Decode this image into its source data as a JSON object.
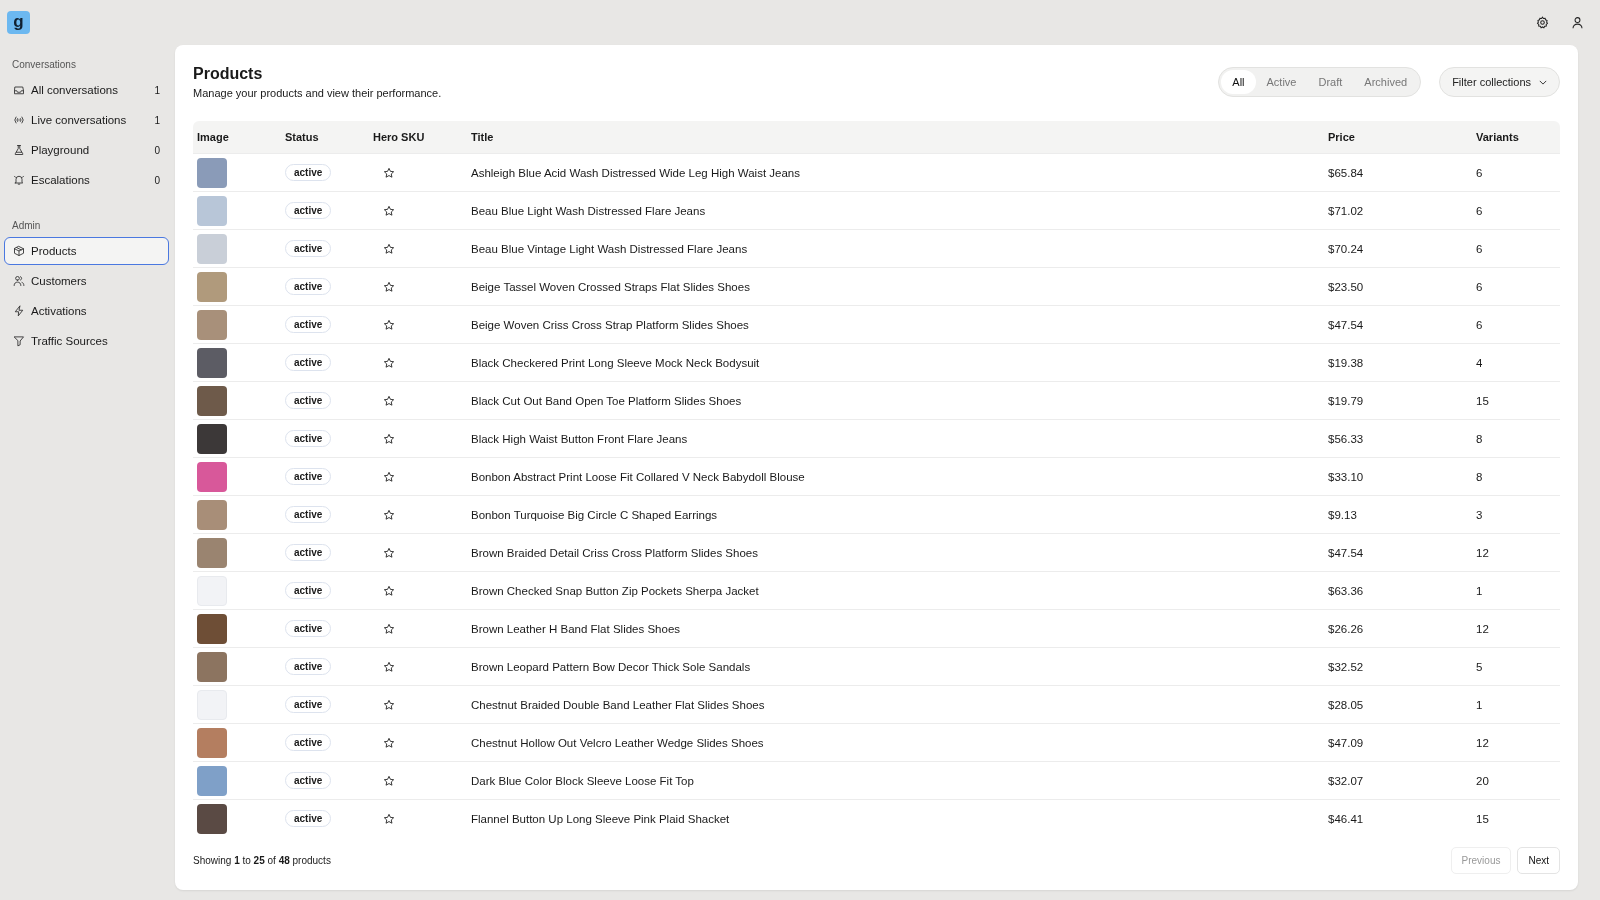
{
  "app": {
    "logo": "g"
  },
  "sidebar": {
    "sections": [
      {
        "heading": "Conversations",
        "items": [
          {
            "label": "All conversations",
            "count": "1",
            "selected": false
          },
          {
            "label": "Live conversations",
            "count": "1",
            "selected": false
          },
          {
            "label": "Playground",
            "count": "0",
            "selected": false
          },
          {
            "label": "Escalations",
            "count": "0",
            "selected": false
          }
        ]
      },
      {
        "heading": "Admin",
        "items": [
          {
            "label": "Products",
            "selected": true
          },
          {
            "label": "Customers",
            "selected": false
          },
          {
            "label": "Activations",
            "selected": false
          },
          {
            "label": "Traffic Sources",
            "selected": false
          }
        ]
      }
    ]
  },
  "page": {
    "title": "Products",
    "subtitle": "Manage your products and view their performance."
  },
  "filters": [
    {
      "label": "All",
      "selected": true
    },
    {
      "label": "Active",
      "selected": false
    },
    {
      "label": "Draft",
      "selected": false
    },
    {
      "label": "Archived",
      "selected": false
    }
  ],
  "collections_filter": {
    "label": "Filter collections"
  },
  "table": {
    "columns": [
      "Image",
      "Status",
      "Hero SKU",
      "Title",
      "Price",
      "Variants"
    ],
    "rows": [
      {
        "has_image": true,
        "status": "active",
        "hero": false,
        "title": "Ashleigh Blue Acid Wash Distressed Wide Leg High Waist Jeans",
        "price": "$65.84",
        "variants": "6"
      },
      {
        "has_image": true,
        "status": "active",
        "hero": false,
        "title": "Beau Blue Light Wash Distressed Flare Jeans",
        "price": "$71.02",
        "variants": "6"
      },
      {
        "has_image": true,
        "status": "active",
        "hero": false,
        "title": "Beau Blue Vintage Light Wash Distressed Flare Jeans",
        "price": "$70.24",
        "variants": "6"
      },
      {
        "has_image": true,
        "status": "active",
        "hero": false,
        "title": "Beige Tassel Woven Crossed Straps Flat Slides Shoes",
        "price": "$23.50",
        "variants": "6"
      },
      {
        "has_image": true,
        "status": "active",
        "hero": false,
        "title": "Beige Woven Criss Cross Strap Platform Slides Shoes",
        "price": "$47.54",
        "variants": "6"
      },
      {
        "has_image": true,
        "status": "active",
        "hero": false,
        "title": "Black Checkered Print Long Sleeve Mock Neck Bodysuit",
        "price": "$19.38",
        "variants": "4"
      },
      {
        "has_image": true,
        "status": "active",
        "hero": false,
        "title": "Black Cut Out Band Open Toe Platform Slides Shoes",
        "price": "$19.79",
        "variants": "15"
      },
      {
        "has_image": true,
        "status": "active",
        "hero": false,
        "title": "Black High Waist Button Front Flare Jeans",
        "price": "$56.33",
        "variants": "8"
      },
      {
        "has_image": true,
        "status": "active",
        "hero": false,
        "title": "Bonbon Abstract Print Loose Fit Collared V Neck Babydoll Blouse",
        "price": "$33.10",
        "variants": "8"
      },
      {
        "has_image": true,
        "status": "active",
        "hero": false,
        "title": "Bonbon Turquoise Big Circle C Shaped Earrings",
        "price": "$9.13",
        "variants": "3"
      },
      {
        "has_image": true,
        "status": "active",
        "hero": false,
        "title": "Brown Braided Detail Criss Cross Platform Slides Shoes",
        "price": "$47.54",
        "variants": "12"
      },
      {
        "has_image": false,
        "status": "active",
        "hero": false,
        "title": "Brown Checked Snap Button Zip Pockets Sherpa Jacket",
        "price": "$63.36",
        "variants": "1"
      },
      {
        "has_image": true,
        "status": "active",
        "hero": false,
        "title": "Brown Leather H Band Flat Slides Shoes",
        "price": "$26.26",
        "variants": "12"
      },
      {
        "has_image": true,
        "status": "active",
        "hero": false,
        "title": "Brown Leopard Pattern Bow Decor Thick Sole Sandals",
        "price": "$32.52",
        "variants": "5"
      },
      {
        "has_image": false,
        "status": "active",
        "hero": false,
        "title": "Chestnut Braided Double Band Leather Flat Slides Shoes",
        "price": "$28.05",
        "variants": "1"
      },
      {
        "has_image": true,
        "status": "active",
        "hero": false,
        "title": "Chestnut Hollow Out Velcro Leather Wedge Slides Shoes",
        "price": "$47.09",
        "variants": "12"
      },
      {
        "has_image": true,
        "status": "active",
        "hero": false,
        "title": "Dark Blue Color Block Sleeve Loose Fit Top",
        "price": "$32.07",
        "variants": "20"
      },
      {
        "has_image": true,
        "status": "active",
        "hero": false,
        "title": "Flannel Button Up Long Sleeve Pink Plaid Shacket",
        "price": "$46.41",
        "variants": "15"
      }
    ]
  },
  "footer": {
    "summary": "Showing **1** to **25** of **48** products"
  },
  "pagination": [
    {
      "label": "Previous",
      "disabled": true
    },
    {
      "label": "Next",
      "disabled": false
    }
  ]
}
